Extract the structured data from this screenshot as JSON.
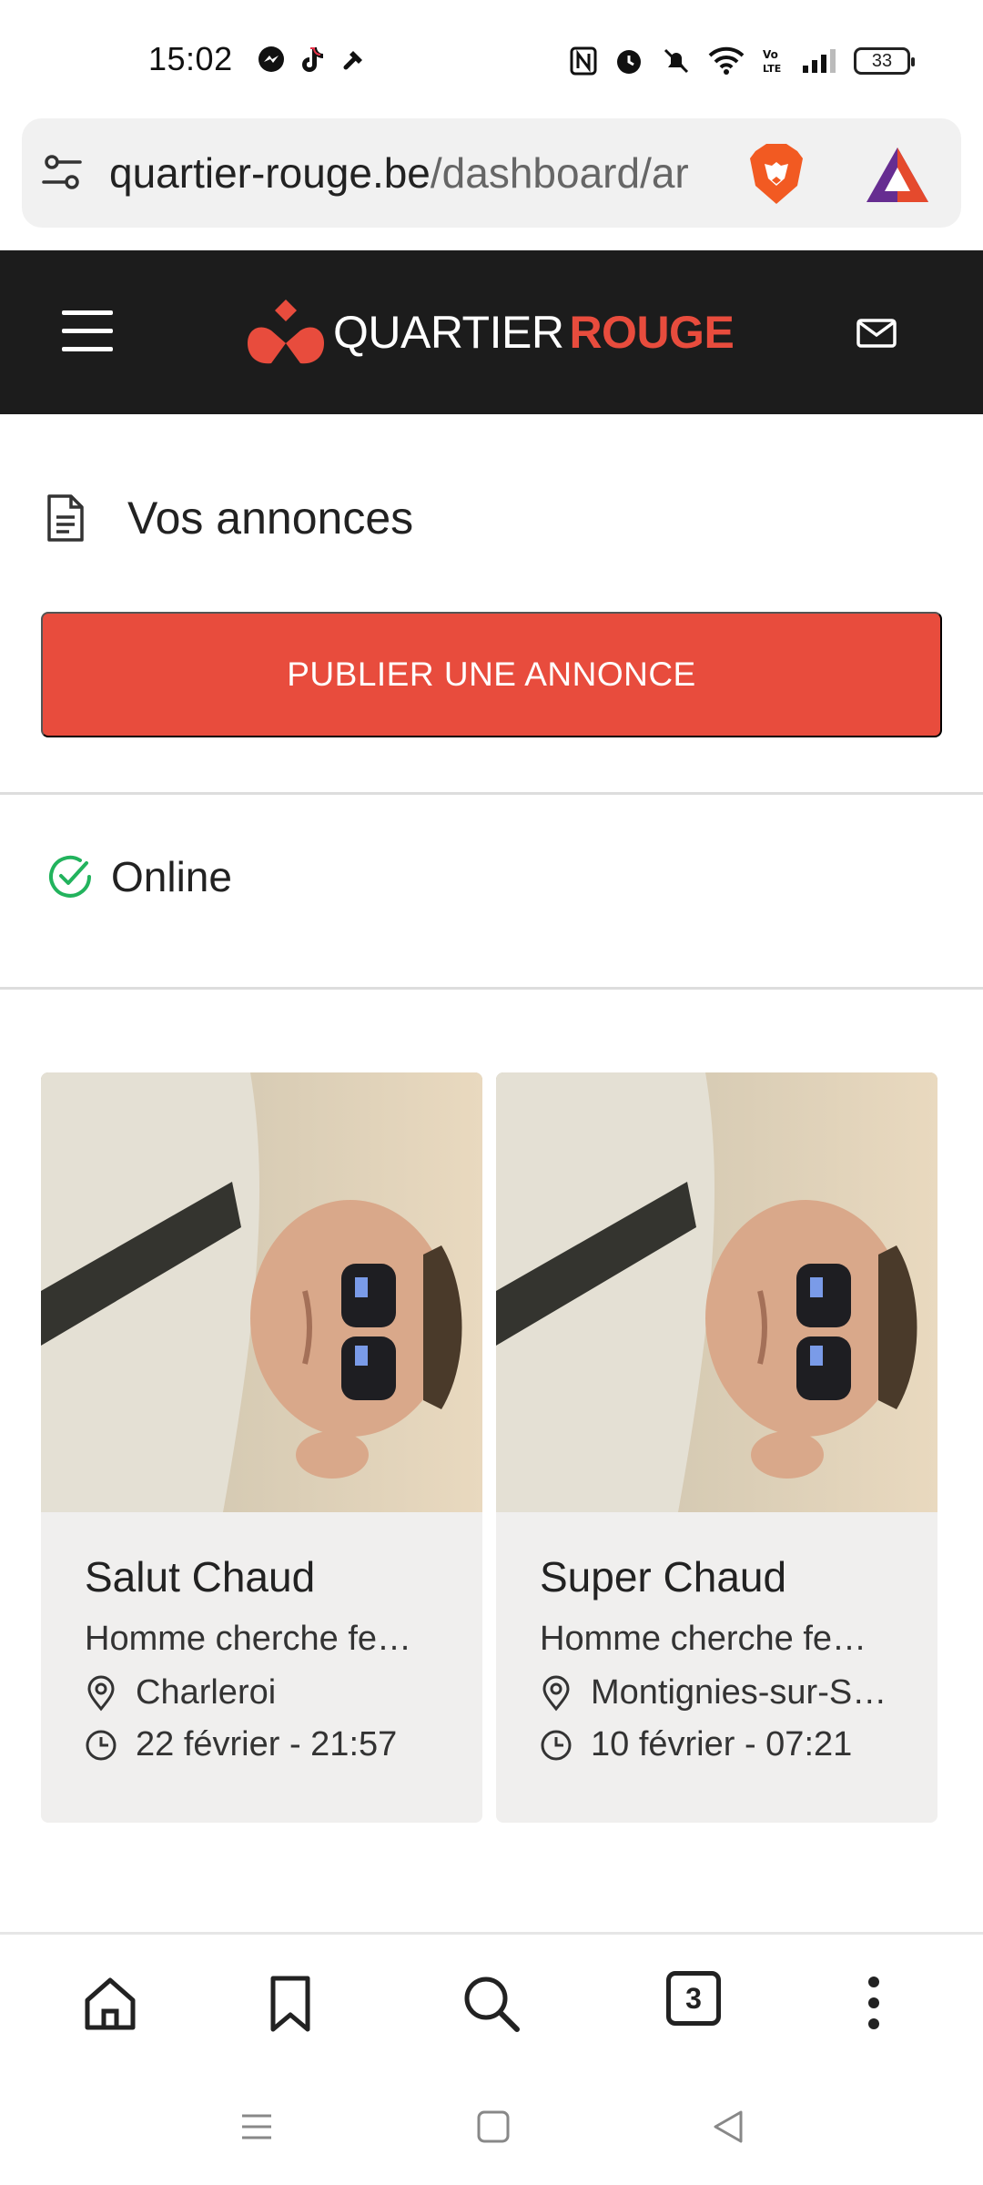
{
  "status_bar": {
    "time": "15:02",
    "battery": "33",
    "left_icons": [
      "messenger-icon",
      "tiktok-icon",
      "tools-icon"
    ],
    "right_icons": [
      "nfc-icon",
      "alarm-icon",
      "silent-icon",
      "wifi-icon",
      "volte-icon",
      "signal-icon",
      "battery-icon"
    ]
  },
  "browser": {
    "url_domain": "quartier-rouge.be",
    "url_path": "/dashboard/ar"
  },
  "site_header": {
    "logo_part1": "QUARTIER",
    "logo_part2": "ROUGE",
    "accent": "#e84c3d"
  },
  "page": {
    "section_title": "Vos annonces",
    "publish_label": "PUBLIER UNE ANNONCE",
    "status_label": "Online"
  },
  "cards": [
    {
      "title": "Salut Chaud",
      "description": "Homme cherche fe…",
      "location": "Charleroi",
      "date": "22 février - 21:57"
    },
    {
      "title": "Super Chaud",
      "description": "Homme cherche fe…",
      "location": "Montignies-sur-S…",
      "date": "10 février - 07:21"
    }
  ],
  "bottom_nav": {
    "tab_count": "3"
  }
}
